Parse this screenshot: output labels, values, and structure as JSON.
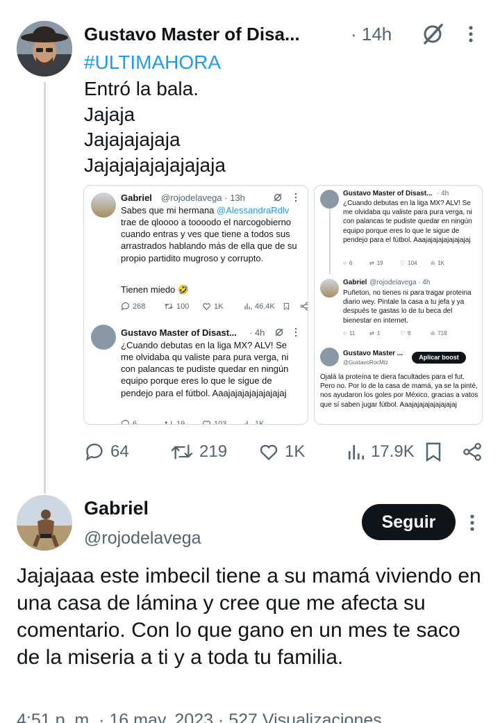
{
  "main_tweet": {
    "author_name": "Gustavo Master of Disa...",
    "time": "· 14h",
    "hashtag": "#ULTIMAHORA",
    "lines": [
      "Entró la bala.",
      "Jajaja",
      "Jajajajajaja",
      "Jajajajajajajajaja"
    ],
    "actions": {
      "replies": "64",
      "retweets": "219",
      "likes": "1K",
      "views": "17.9K"
    }
  },
  "embedded_left": {
    "tweet1": {
      "name": "Gabriel",
      "meta": "@rojodelavega · 13h",
      "text_before": "Sabes que mi hermana ",
      "mention": "@AlessandraRdlv",
      "text_after": " trae de qloooo a toooodo el narcogobierno cuando entras y ves que tiene a todos sus arrastrados hablando más de ella que de su propio partidito mugroso y corrupto.",
      "text2": "Tienen miedo 🤣",
      "replies": "268",
      "retweets": "100",
      "likes": "1K",
      "views": "46.4K"
    },
    "tweet2": {
      "name": "Gustavo Master of Disast...",
      "meta": "· 4h",
      "text": "¿Cuando debutas en la liga MX?  ALV! Se me olvidaba qu valiste para pura verga, ni con palancas te pudiste quedar en ningún equipo porque eres lo que le sigue de pendejo para el fútbol. Aaajajajajajajajajaj",
      "replies": "6",
      "retweets": "19",
      "likes": "103",
      "views": "1K"
    }
  },
  "embedded_right": {
    "tweet1": {
      "name": "Gustavo Master of Disast...",
      "meta": "· 4h",
      "text": "¿Cuando debutas en la liga MX? ALV! Se me olvidaba qu valiste para pura verga, ni con palancas te pudiste quedar en ningún equipo porque eres lo que le sigue de pendejo para el fútbol. Aaajajajajajajajajaj",
      "replies": "6",
      "retweets": "19",
      "likes": "104",
      "views": "1K"
    },
    "tweet2": {
      "name": "Gabriel",
      "meta": "@rojodelavega · 4h",
      "text": "Puñeton, no tienes ni para tragar proteina diario wey. Pintale la casa a tu jefa y ya después te gastas lo de tu beca del bienestar en internet.",
      "replies": "11",
      "retweets": "1",
      "likes": "6",
      "views": "718"
    },
    "tweet3": {
      "name": "Gustavo Master ...",
      "handle": "@GustavoRocMtz",
      "boost": "Aplicar boost",
      "text": "Ojalá la proteína te diera facultades para el fut. Pero no. Por lo de la casa de mamá, ya se la pinté, nos ayudaron los goles por México, gracias a vatos que sí saben jugar fútbol. Aaajajajajajajajajaj"
    }
  },
  "reply_tweet": {
    "author_name": "Gabriel",
    "handle": "@rojodelavega",
    "follow_label": "Seguir",
    "body": "Jajajaaa este imbecil tiene a su mamá viviendo en una casa de lámina y cree que me afecta su comentario. Con lo que gano en un mes te saco de la miseria a ti y a toda tu familia.",
    "footer": "4:51 p. m. · 16 may. 2023 · 527 Visualizaciones"
  },
  "colors": {
    "link": "#1d9bf0",
    "text": "#0f1419",
    "muted": "#536471",
    "border": "#cfd9de"
  }
}
